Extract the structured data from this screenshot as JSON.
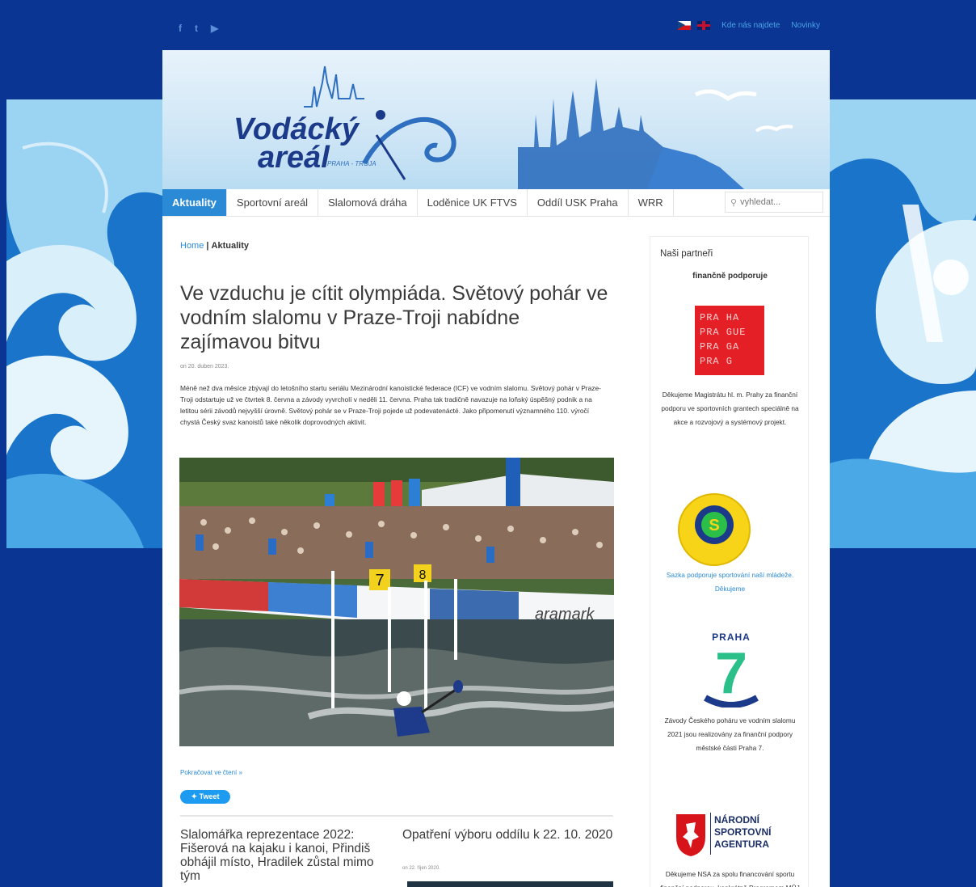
{
  "social": {
    "facebook": "f",
    "twitter": "t",
    "youtube": "▶"
  },
  "toplinks": {
    "find_us": "Kde nás najdete",
    "news": "Novinky"
  },
  "logo": {
    "line1": "Vodácký",
    "line2": "areál",
    "tag": "PRAHA - TROJA"
  },
  "nav": {
    "items": [
      "Aktuality",
      "Sportovní areál",
      "Slalomová dráha",
      "Loděnice UK FTVS",
      "Oddíl USK Praha",
      "WRR"
    ],
    "search_placeholder": "vyhledat..."
  },
  "breadcrumb": {
    "home": "Home",
    "sep": "|",
    "current": "Aktuality"
  },
  "article": {
    "title": "Ve vzduchu je cítit olympiáda. Světový pohár ve vodním slalomu v Praze-Troji nabídne zajímavou bitvu",
    "date": "on 20. duben 2023.",
    "body": "Méně než dva měsíce zbývají do letošního startu seriálu Mezinárodní kanoistické federace (ICF) ve vodním slalomu. Světový pohár v Praze-Troji odstartuje už ve čtvrtek 8. června a závody vyvrcholí v neděli 11. června. Praha tak tradičně navazuje na loňský úspěšný podnik a na letitou sérii závodů nejvyšší úrovně. Světový pohár se v Praze-Troji pojede už podevatenácté. Jako připomenutí významného 110. výročí chystá Český svaz kanoistů také několik doprovodných aktivit.",
    "read_more": "Pokračovat ve čtení »",
    "tweet": "Tweet",
    "gate_numbers": [
      "7",
      "8"
    ]
  },
  "posts": [
    {
      "title": "Slalomářka reprezentace 2022: Fišerová na kajaku i kanoi, Přindiš obhájil místo, Hradilek zůstal mimo tým"
    },
    {
      "title": "Opatření výboru oddílu k 22. 10. 2020",
      "date": "on 22. říjen 2020."
    }
  ],
  "sidebar": {
    "title": "Naši partneři",
    "subtitle": "finančně podporuje",
    "praha_logo": [
      "PRA HA",
      "PRA GUE",
      "PRA GA",
      "PRA G"
    ],
    "magistrat_text": "Děkujeme Magistrátu hl. m. Prahy za finanční podporu ve sportovních grantech speciálně na akce a rozvojový a systémový projekt.",
    "sazka_text": "Sazka podporuje sportování naší mládeže. Děkujeme",
    "praha7_title": "PRAHA",
    "praha7_number": "7",
    "praha7_text": "Závody Českého poháru ve vodním slalomu 2021 jsou realizovány za finanční podpory městské části Praha 7.",
    "nsa_lines": [
      "NÁRODNÍ",
      "SPORTOVNÍ",
      "AGENTURA"
    ],
    "nsa_text": "Děkujeme NSA za spolu financování sportu finanční podporou, konkrétně Programem MŮJ KLUB a VSA."
  },
  "colors": {
    "background": "#0a3593",
    "accent": "#2b8ad6",
    "praha_red": "#e41f26"
  }
}
